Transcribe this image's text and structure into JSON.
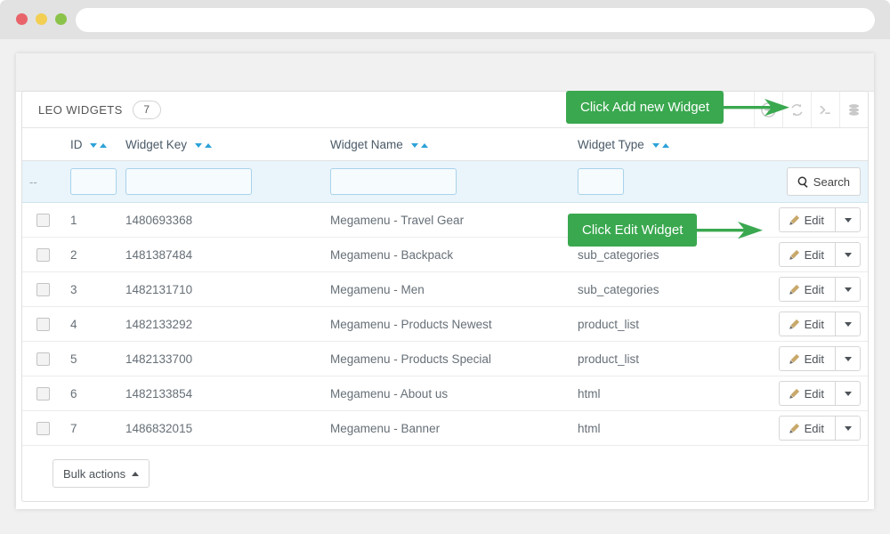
{
  "browser": {
    "traffic_lights": [
      "close",
      "minimize",
      "maximize"
    ],
    "address_value": "",
    "address_placeholder": ""
  },
  "panel": {
    "title": "LEO WIDGETS",
    "count": "7",
    "tools": [
      {
        "name": "add-widget-icon",
        "icon": "plus-circle"
      },
      {
        "name": "refresh-icon",
        "icon": "refresh"
      },
      {
        "name": "console-icon",
        "icon": "terminal"
      },
      {
        "name": "database-icon",
        "icon": "database"
      }
    ]
  },
  "table": {
    "columns": [
      {
        "key": "id",
        "label": "ID"
      },
      {
        "key": "widget_key",
        "label": "Widget Key"
      },
      {
        "key": "widget_name",
        "label": "Widget Name"
      },
      {
        "key": "widget_type",
        "label": "Widget Type"
      }
    ],
    "filter": {
      "dash": "--",
      "id_value": "",
      "key_value": "",
      "name_value": "",
      "type_value": "",
      "search_label": "Search"
    },
    "rows": [
      {
        "id": "1",
        "widget_key": "1480693368",
        "widget_name": "Megamenu - Travel Gear",
        "widget_type": "",
        "action": "Edit"
      },
      {
        "id": "2",
        "widget_key": "1481387484",
        "widget_name": "Megamenu - Backpack",
        "widget_type": "sub_categories",
        "action": "Edit"
      },
      {
        "id": "3",
        "widget_key": "1482131710",
        "widget_name": "Megamenu - Men",
        "widget_type": "sub_categories",
        "action": "Edit"
      },
      {
        "id": "4",
        "widget_key": "1482133292",
        "widget_name": "Megamenu - Products Newest",
        "widget_type": "product_list",
        "action": "Edit"
      },
      {
        "id": "5",
        "widget_key": "1482133700",
        "widget_name": "Megamenu - Products Special",
        "widget_type": "product_list",
        "action": "Edit"
      },
      {
        "id": "6",
        "widget_key": "1482133854",
        "widget_name": "Megamenu - About us",
        "widget_type": "html",
        "action": "Edit"
      },
      {
        "id": "7",
        "widget_key": "1486832015",
        "widget_name": "Megamenu - Banner",
        "widget_type": "html",
        "action": "Edit"
      }
    ]
  },
  "footer": {
    "bulk_actions_label": "Bulk actions"
  },
  "callouts": [
    {
      "id": "add",
      "text": "Click Add new Widget"
    },
    {
      "id": "edit",
      "text": "Click Edit Widget"
    }
  ],
  "colors": {
    "callout_green": "#3aa css",
    "accent_blue": "#2da2d8",
    "filter_row": "#e9f4fb"
  }
}
